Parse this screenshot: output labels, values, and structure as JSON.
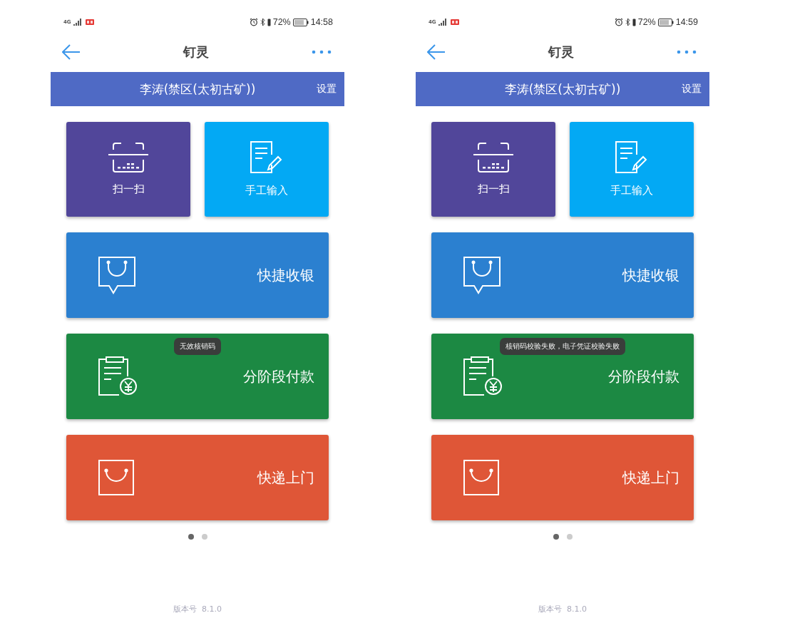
{
  "phones": [
    {
      "status_bar": {
        "network": "4G",
        "battery_percent": "72%",
        "time": "14:58"
      },
      "nav": {
        "title": "钉灵"
      },
      "banner": {
        "user": "李涛(禁区(太初古矿))",
        "settings": "设置"
      },
      "tiles": [
        {
          "kind": "small",
          "label": "扫一扫",
          "color": "#51469a"
        },
        {
          "kind": "small",
          "label": "手工输入",
          "color": "#03a9f4"
        },
        {
          "kind": "wide",
          "label": "快捷收银",
          "color": "#2b80d0"
        },
        {
          "kind": "wide",
          "label": "分阶段付款",
          "color": "#1c8943",
          "toast": "无效核销码"
        },
        {
          "kind": "wide",
          "label": "快递上门",
          "color": "#df5637"
        }
      ],
      "pager": [
        {
          "selected": true
        },
        {
          "selected": false
        }
      ],
      "version": "版本号  8.1.0"
    },
    {
      "status_bar": {
        "network": "4G",
        "battery_percent": "72%",
        "time": "14:59"
      },
      "nav": {
        "title": "钉灵"
      },
      "banner": {
        "user": "李涛(禁区(太初古矿))",
        "settings": "设置"
      },
      "tiles": [
        {
          "kind": "small",
          "label": "扫一扫",
          "color": "#51469a"
        },
        {
          "kind": "small",
          "label": "手工输入",
          "color": "#03a9f4"
        },
        {
          "kind": "wide",
          "label": "快捷收银",
          "color": "#2b80d0"
        },
        {
          "kind": "wide",
          "label": "分阶段付款",
          "color": "#1c8943",
          "toast": "核销码校验失败，电子凭证校验失败"
        },
        {
          "kind": "wide",
          "label": "快递上门",
          "color": "#df5637"
        }
      ],
      "pager": [
        {
          "selected": true
        },
        {
          "selected": false
        }
      ],
      "version": "版本号  8.1.0"
    }
  ]
}
